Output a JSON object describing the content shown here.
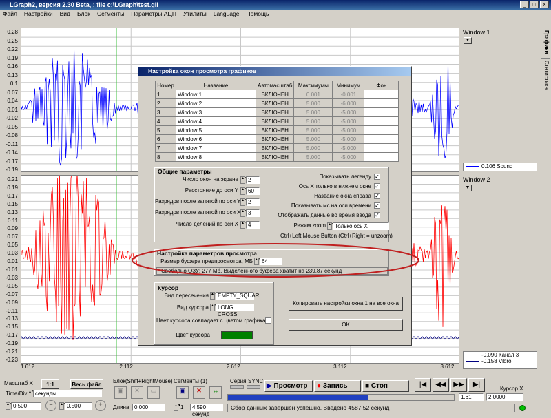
{
  "window": {
    "title": "LGraph2, версия  2.30 Beta, ; file c:\\LGraph\\test.gll",
    "min": "_",
    "max": "□",
    "close": "×"
  },
  "menu": [
    "Файл",
    "Настройки",
    "Вид",
    "Блок",
    "Сегменты",
    "Параметры АЦП",
    "Утилиты",
    "Language",
    "Помощь"
  ],
  "chart_data": [
    {
      "type": "line",
      "name": "Window 1",
      "yticks": [
        "0.28",
        "0.25",
        "0.22",
        "0.19",
        "0.16",
        "0.13",
        "0.1",
        "0.07",
        "0.04",
        "0.01",
        "-0.02",
        "-0.05",
        "-0.08",
        "-0.11",
        "-0.14",
        "-0.17",
        "-0.19"
      ],
      "ylim": [
        -0.19,
        0.28
      ],
      "legend": "0.106 Sound",
      "color": "#0000ff"
    },
    {
      "type": "line",
      "name": "Window 2",
      "yticks": [
        "0.21",
        "0.19",
        "0.17",
        "0.15",
        "0.13",
        "0.11",
        "0.09",
        "0.07",
        "0.05",
        "0.03",
        "0.01",
        "-0.01",
        "-0.03",
        "-0.05",
        "-0.07",
        "-0.09",
        "-0.11",
        "-0.13",
        "-0.15",
        "-0.17",
        "-0.19",
        "-0.21",
        "-0.23"
      ],
      "ylim": [
        -0.23,
        0.21
      ],
      "xticks": [
        "1.612",
        "2.112",
        "2.612",
        "3.112",
        "3.612"
      ],
      "xlim": [
        1.612,
        3.662
      ],
      "legend": [
        {
          "name": "-0.090 Канал 3",
          "color": "#ff0000"
        },
        {
          "name": "-0.158 Vibro",
          "color": "#000080"
        }
      ]
    }
  ],
  "right_tabs": [
    "Графики",
    "Статистика"
  ],
  "dialog": {
    "title": "Настройка окон просмотра графиков",
    "table": {
      "headers": [
        "Номер",
        "Название",
        "Автомасштаб",
        "Максимумы",
        "Минимум",
        "Фон"
      ],
      "rows": [
        [
          "1",
          "Window 1",
          "ВКЛЮЧЕН",
          "0.001",
          "-0.001"
        ],
        [
          "2",
          "Window 2",
          "ВКЛЮЧЕН",
          "5.000",
          "-6.000"
        ],
        [
          "3",
          "Window 3",
          "ВКЛЮЧЕН",
          "5.000",
          "-5.000"
        ],
        [
          "4",
          "Window 4",
          "ВКЛЮЧЕН",
          "5.000",
          "-5.000"
        ],
        [
          "5",
          "Window 5",
          "ВКЛЮЧЕН",
          "5.000",
          "-5.000"
        ],
        [
          "6",
          "Window 6",
          "ВКЛЮЧЕН",
          "5.000",
          "-5.000"
        ],
        [
          "7",
          "Window 7",
          "ВКЛЮЧЕН",
          "5.000",
          "-5.000"
        ],
        [
          "8",
          "Window 8",
          "ВКЛЮЧЕН",
          "5.000",
          "-5.000"
        ]
      ]
    },
    "general": {
      "title": "Общие параметры",
      "windows_on_screen": {
        "label": "Число окон на экране",
        "value": "2"
      },
      "distance_y": {
        "label": "Расстояние до оси Y",
        "value": "60"
      },
      "decimals_y": {
        "label": "Разрядов после запятой по оси Y",
        "value": "2"
      },
      "decimals_x": {
        "label": "Разрядов после запятой по оси X",
        "value": "3"
      },
      "divisions_x": {
        "label": "Число делений по оси X",
        "value": "4"
      },
      "show_legend": "Показывать легенду",
      "x_axis_bottom": "Ось X только в нижнем окне",
      "window_name_right": "Название окна справа",
      "show_ms": "Показывать мс на оси времени",
      "show_during_input": "Отображать данные во время ввода",
      "zoom_label": "Режим zoom",
      "zoom_value": "Только ось X",
      "zoom_hint": "Ctrl+Left Mouse Button (Ctrl+Right = unzoom)"
    },
    "view": {
      "title": "Настройка параметров просмотра",
      "buffer_label": "Размер буфера предпросмотра, МБ",
      "buffer_value": "64",
      "status": "Свободно ОЗУ: 277 Мб.   Выделенного буфера хватит на 239.87 секунд"
    },
    "cursor": {
      "title": "Курсор",
      "cross_label": "Вид пересечения",
      "cross_value": "EMPTY_SQUAR",
      "kind_label": "Вид курсора",
      "kind_value": "LONG CROSS",
      "match_color": "Цвет курсора совпадает с цветом графика",
      "color_label": "Цвет курсора",
      "color": "#008000"
    },
    "copy_button": "Копировать настройки окна 1 на все окна",
    "ok_button": "OK"
  },
  "bottom": {
    "scale_label": "Масштаб X",
    "scale_btn": "1:1",
    "full_file": "Весь файл",
    "timediv_label": "Time/Div",
    "timediv_value": "секунды",
    "zoom_left": "0.500",
    "zoom_right": "0.500",
    "block_label": "Блок(Shift+RightMouse)",
    "length_label": "Длина",
    "length_value": "0.000",
    "segments_label": "Сегменты (1)",
    "seg_index": "1",
    "seg_value": "4.590 секунд",
    "series_label": "Серия",
    "sync_label": "SYNC",
    "preview_btn": "Просмотр",
    "record_btn": "Запись",
    "stop_btn": "Стоп",
    "progress": 0.62,
    "position_value": "1.61",
    "cursor_x_label": "Курсор X",
    "cursor_x_value": "2.0000",
    "status": "Сбор данных завершен успешно. Введено 4587.52 секунд"
  }
}
